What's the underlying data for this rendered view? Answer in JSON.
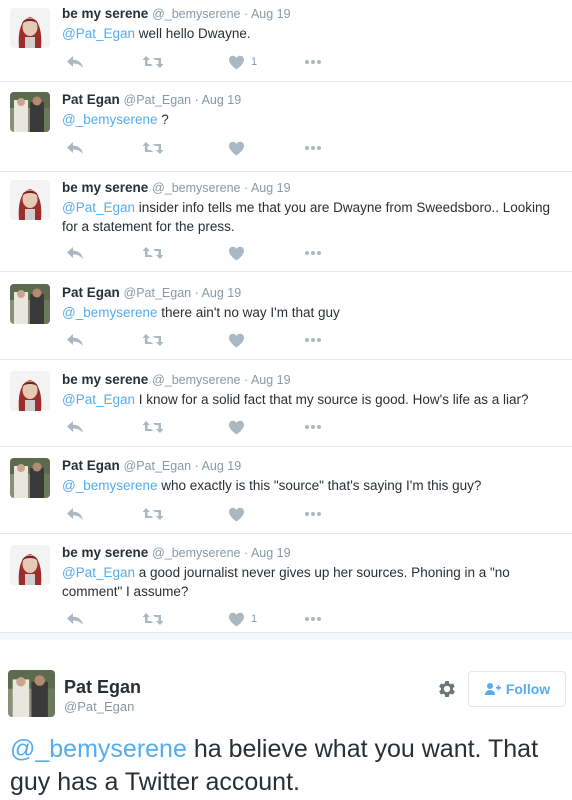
{
  "tweets": [
    {
      "author": "be my serene",
      "handle": "@_bemyserene",
      "date": "Aug 19",
      "mention": "@Pat_Egan",
      "text": "well hello Dwayne.",
      "likes": "1",
      "avatar": "serene"
    },
    {
      "author": "Pat Egan",
      "handle": "@Pat_Egan",
      "date": "Aug 19",
      "mention": "@_bemyserene",
      "text": "?",
      "likes": "",
      "avatar": "pat"
    },
    {
      "author": "be my serene",
      "handle": "@_bemyserene",
      "date": "Aug 19",
      "mention": "@Pat_Egan",
      "text": "insider info tells me that you are Dwayne from Sweedsboro.. Looking for a statement for the press.",
      "likes": "",
      "avatar": "serene"
    },
    {
      "author": "Pat Egan",
      "handle": "@Pat_Egan",
      "date": "Aug 19",
      "mention": "@_bemyserene",
      "text": "there ain't no way I'm that guy",
      "likes": "",
      "avatar": "pat"
    },
    {
      "author": "be my serene",
      "handle": "@_bemyserene",
      "date": "Aug 19",
      "mention": "@Pat_Egan",
      "text": "I know for a solid fact that my source is good. How's life as a liar?",
      "likes": "",
      "avatar": "serene"
    },
    {
      "author": "Pat Egan",
      "handle": "@Pat_Egan",
      "date": "Aug 19",
      "mention": "@_bemyserene",
      "text": "who exactly is this \"source\" that's saying I'm this guy?",
      "likes": "",
      "avatar": "pat"
    },
    {
      "author": "be my serene",
      "handle": "@_bemyserene",
      "date": "Aug 19",
      "mention": "@Pat_Egan",
      "text": "a good journalist never gives up her sources. Phoning in a \"no comment\" I assume?",
      "likes": "1",
      "avatar": "serene"
    }
  ],
  "focused": {
    "author": "Pat Egan",
    "handle": "@Pat_Egan",
    "follow_label": "Follow",
    "mention": "@_bemyserene",
    "text": "ha believe what you want. That guy has a Twitter account."
  },
  "icons": {
    "reply": "reply-icon",
    "retweet": "retweet-icon",
    "like": "heart-icon",
    "more": "more-dots-icon",
    "settings": "gear-icon",
    "follow": "add-user-icon"
  },
  "colors": {
    "mention": "#55acee",
    "muted": "#8899a6",
    "icon": "#aab8c2",
    "text": "#292f33",
    "divider": "#e1e8ed"
  }
}
